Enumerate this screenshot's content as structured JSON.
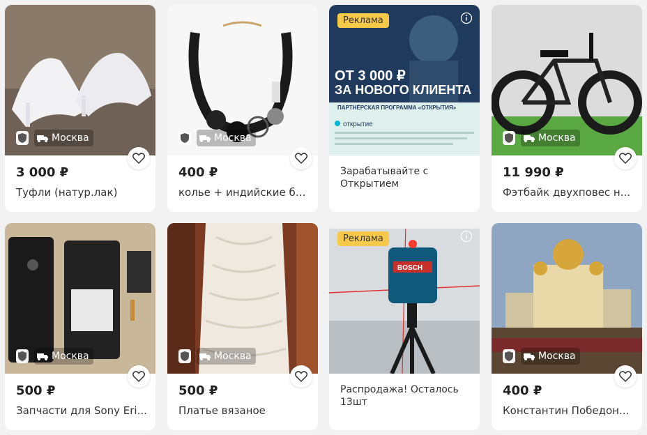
{
  "cards": [
    {
      "price": "3 000 ₽",
      "title": "Туфли (натур.лак)",
      "location": "Москва"
    },
    {
      "price": "400 ₽",
      "title": "колье + индийские бр...",
      "location": "Москва"
    },
    {
      "ad_label": "Реклама",
      "text": "Зарабатывайте с Открытием",
      "banner_headline": "ОТ 3 000 ₽ ЗА НОВОГО КЛИЕНТА",
      "banner_sub": "ПАРТНЁРСКАЯ ПРОГРАММА «ОТКРЫТИЯ»",
      "banner_brand": "открытие"
    },
    {
      "price": "11 990 ₽",
      "title": "Фэтбайк двухповес н...",
      "location": "Москва"
    },
    {
      "price": "500 ₽",
      "title": "Запчасти для Sony Eri...",
      "location": "Москва"
    },
    {
      "price": "500 ₽",
      "title": "Платье вязаное",
      "location": "Москва"
    },
    {
      "ad_label": "Реклама",
      "text": "Распродажа! Осталось 13шт",
      "banner_brand": "BOSCH"
    },
    {
      "price": "400 ₽",
      "title": "Константин Победон...",
      "location": "Москва"
    }
  ],
  "colors": {
    "background": "#f2f2f2",
    "ad_badge": "#f7c948",
    "price_text": "#222222"
  },
  "icons": {
    "favorite": "heart-outline-icon",
    "delivery": "truck-icon",
    "verified": "shield-icon",
    "ad_info": "info-icon"
  }
}
